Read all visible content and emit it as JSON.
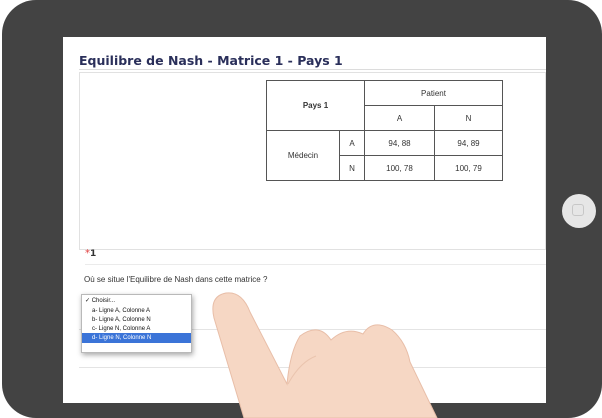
{
  "page": {
    "title": "Equilibre de Nash - Matrice 1 - Pays 1"
  },
  "matrix": {
    "corner_label": "Pays 1",
    "column_player": "Patient",
    "column_strategies": [
      "A",
      "N"
    ],
    "row_player": "Médecin",
    "row_strategies": [
      "A",
      "N"
    ],
    "payoffs": [
      [
        "94, 88",
        "94, 89"
      ],
      [
        "100, 78",
        "100, 79"
      ]
    ]
  },
  "question": {
    "required_marker": "*",
    "number": "1",
    "text": "Où se situe l'Equilibre de Nash dans cette matrice ?"
  },
  "dropdown": {
    "checkmark": "✓",
    "placeholder": "Choisir...",
    "options": [
      "a- Ligne A, Colonne A",
      "b- Ligne A, Colonne N",
      "c- Ligne N, Colonne A",
      "d- Ligne N, Colonne N"
    ],
    "highlighted_index": 3
  }
}
